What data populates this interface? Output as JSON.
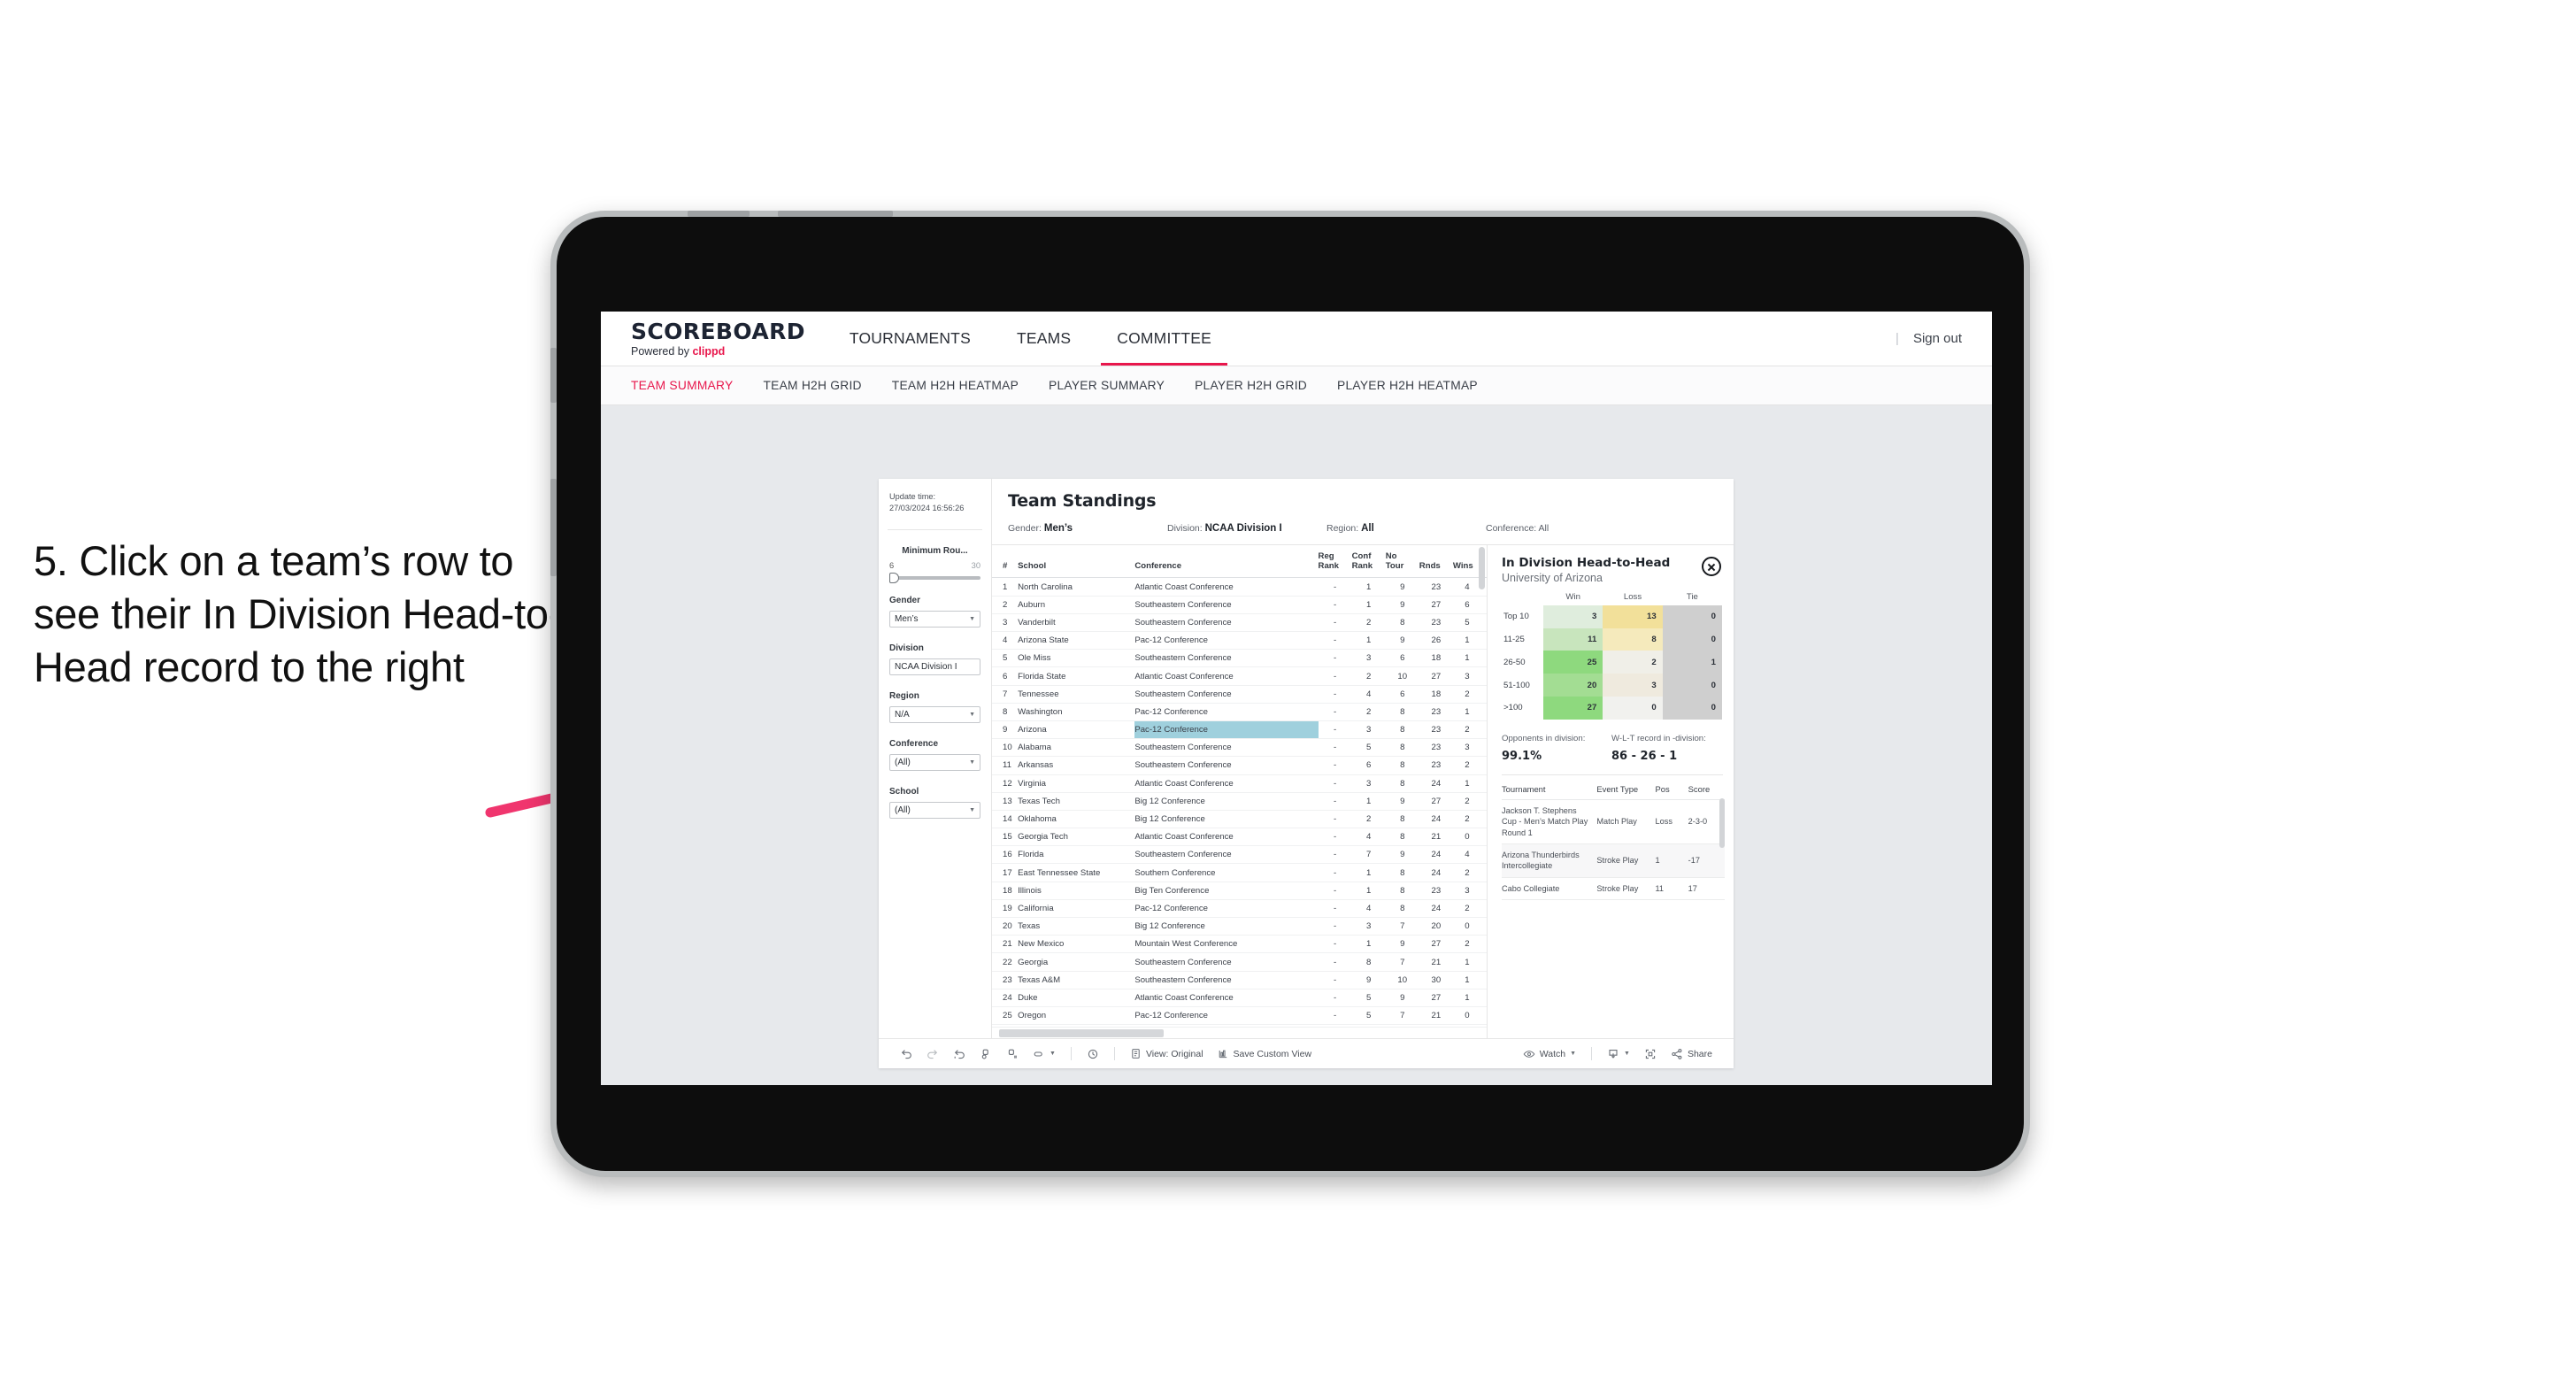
{
  "caption": "5. Click on a team’s row to see their In Division Head-to-Head record to the right",
  "appbar": {
    "logo": "SCOREBOARD",
    "powered_prefix": "Powered by ",
    "powered_brand": "clippd",
    "nav": [
      {
        "label": "TOURNAMENTS",
        "active": false
      },
      {
        "label": "TEAMS",
        "active": false
      },
      {
        "label": "COMMITTEE",
        "active": true
      }
    ],
    "divider": "|",
    "signout": "Sign out"
  },
  "subnav": [
    {
      "label": "TEAM SUMMARY",
      "active": true
    },
    {
      "label": "TEAM H2H GRID",
      "active": false
    },
    {
      "label": "TEAM H2H HEATMAP",
      "active": false
    },
    {
      "label": "PLAYER SUMMARY",
      "active": false
    },
    {
      "label": "PLAYER H2H GRID",
      "active": false
    },
    {
      "label": "PLAYER H2H HEATMAP",
      "active": false
    }
  ],
  "rail": {
    "update_label": "Update time:",
    "update_value": "27/03/2024 16:56:26",
    "slider": {
      "title": "Minimum Rou...",
      "min": "6",
      "max": "30"
    },
    "filters": [
      {
        "label": "Gender",
        "value": "Men’s"
      },
      {
        "label": "Division",
        "value": "NCAA Division I"
      },
      {
        "label": "Region",
        "value": "N/A"
      },
      {
        "label": "Conference",
        "value": "(All)"
      },
      {
        "label": "School",
        "value": "(All)"
      }
    ]
  },
  "standings": {
    "title": "Team Standings",
    "facets": [
      {
        "label": "Gender:",
        "value": "Men’s"
      },
      {
        "label": "Division:",
        "value": "NCAA Division I"
      },
      {
        "label": "Region:",
        "value": "All"
      },
      {
        "label": "Conference:",
        "value": "All"
      }
    ],
    "columns": [
      "#",
      "School",
      "Conference",
      "Reg Rank",
      "Conf Rank",
      "No Tour",
      "Rnds",
      "Wins"
    ],
    "columns_display": [
      {
        "l1": "#",
        "l2": ""
      },
      {
        "l1": "School",
        "l2": ""
      },
      {
        "l1": "Conference",
        "l2": ""
      },
      {
        "l1": "Reg",
        "l2": "Rank"
      },
      {
        "l1": "Conf",
        "l2": "Rank"
      },
      {
        "l1": "No",
        "l2": "Tour"
      },
      {
        "l1": "Rnds",
        "l2": ""
      },
      {
        "l1": "Wins",
        "l2": ""
      }
    ],
    "selected_row_index": 8,
    "rows": [
      {
        "n": "1",
        "school": "North Carolina",
        "conf": "Atlantic Coast Conference",
        "reg": "-",
        "crank": "1",
        "notour": "9",
        "rnds": "23",
        "wins": "4"
      },
      {
        "n": "2",
        "school": "Auburn",
        "conf": "Southeastern Conference",
        "reg": "-",
        "crank": "1",
        "notour": "9",
        "rnds": "27",
        "wins": "6"
      },
      {
        "n": "3",
        "school": "Vanderbilt",
        "conf": "Southeastern Conference",
        "reg": "-",
        "crank": "2",
        "notour": "8",
        "rnds": "23",
        "wins": "5"
      },
      {
        "n": "4",
        "school": "Arizona State",
        "conf": "Pac-12 Conference",
        "reg": "-",
        "crank": "1",
        "notour": "9",
        "rnds": "26",
        "wins": "1"
      },
      {
        "n": "5",
        "school": "Ole Miss",
        "conf": "Southeastern Conference",
        "reg": "-",
        "crank": "3",
        "notour": "6",
        "rnds": "18",
        "wins": "1"
      },
      {
        "n": "6",
        "school": "Florida State",
        "conf": "Atlantic Coast Conference",
        "reg": "-",
        "crank": "2",
        "notour": "10",
        "rnds": "27",
        "wins": "3"
      },
      {
        "n": "7",
        "school": "Tennessee",
        "conf": "Southeastern Conference",
        "reg": "-",
        "crank": "4",
        "notour": "6",
        "rnds": "18",
        "wins": "2"
      },
      {
        "n": "8",
        "school": "Washington",
        "conf": "Pac-12 Conference",
        "reg": "-",
        "crank": "2",
        "notour": "8",
        "rnds": "23",
        "wins": "1"
      },
      {
        "n": "9",
        "school": "Arizona",
        "conf": "Pac-12 Conference",
        "reg": "-",
        "crank": "3",
        "notour": "8",
        "rnds": "23",
        "wins": "2"
      },
      {
        "n": "10",
        "school": "Alabama",
        "conf": "Southeastern Conference",
        "reg": "-",
        "crank": "5",
        "notour": "8",
        "rnds": "23",
        "wins": "3"
      },
      {
        "n": "11",
        "school": "Arkansas",
        "conf": "Southeastern Conference",
        "reg": "-",
        "crank": "6",
        "notour": "8",
        "rnds": "23",
        "wins": "2"
      },
      {
        "n": "12",
        "school": "Virginia",
        "conf": "Atlantic Coast Conference",
        "reg": "-",
        "crank": "3",
        "notour": "8",
        "rnds": "24",
        "wins": "1"
      },
      {
        "n": "13",
        "school": "Texas Tech",
        "conf": "Big 12 Conference",
        "reg": "-",
        "crank": "1",
        "notour": "9",
        "rnds": "27",
        "wins": "2"
      },
      {
        "n": "14",
        "school": "Oklahoma",
        "conf": "Big 12 Conference",
        "reg": "-",
        "crank": "2",
        "notour": "8",
        "rnds": "24",
        "wins": "2"
      },
      {
        "n": "15",
        "school": "Georgia Tech",
        "conf": "Atlantic Coast Conference",
        "reg": "-",
        "crank": "4",
        "notour": "8",
        "rnds": "21",
        "wins": "0"
      },
      {
        "n": "16",
        "school": "Florida",
        "conf": "Southeastern Conference",
        "reg": "-",
        "crank": "7",
        "notour": "9",
        "rnds": "24",
        "wins": "4"
      },
      {
        "n": "17",
        "school": "East Tennessee State",
        "conf": "Southern Conference",
        "reg": "-",
        "crank": "1",
        "notour": "8",
        "rnds": "24",
        "wins": "2"
      },
      {
        "n": "18",
        "school": "Illinois",
        "conf": "Big Ten Conference",
        "reg": "-",
        "crank": "1",
        "notour": "8",
        "rnds": "23",
        "wins": "3"
      },
      {
        "n": "19",
        "school": "California",
        "conf": "Pac-12 Conference",
        "reg": "-",
        "crank": "4",
        "notour": "8",
        "rnds": "24",
        "wins": "2"
      },
      {
        "n": "20",
        "school": "Texas",
        "conf": "Big 12 Conference",
        "reg": "-",
        "crank": "3",
        "notour": "7",
        "rnds": "20",
        "wins": "0"
      },
      {
        "n": "21",
        "school": "New Mexico",
        "conf": "Mountain West Conference",
        "reg": "-",
        "crank": "1",
        "notour": "9",
        "rnds": "27",
        "wins": "2"
      },
      {
        "n": "22",
        "school": "Georgia",
        "conf": "Southeastern Conference",
        "reg": "-",
        "crank": "8",
        "notour": "7",
        "rnds": "21",
        "wins": "1"
      },
      {
        "n": "23",
        "school": "Texas A&M",
        "conf": "Southeastern Conference",
        "reg": "-",
        "crank": "9",
        "notour": "10",
        "rnds": "30",
        "wins": "1"
      },
      {
        "n": "24",
        "school": "Duke",
        "conf": "Atlantic Coast Conference",
        "reg": "-",
        "crank": "5",
        "notour": "9",
        "rnds": "27",
        "wins": "1"
      },
      {
        "n": "25",
        "school": "Oregon",
        "conf": "Pac-12 Conference",
        "reg": "-",
        "crank": "5",
        "notour": "7",
        "rnds": "21",
        "wins": "0"
      }
    ]
  },
  "h2h": {
    "title": "In Division Head-to-Head",
    "subtitle": "University of Arizona",
    "close_icon": "close-circle-icon",
    "matrix_headers": [
      "Win",
      "Loss",
      "Tie"
    ],
    "matrix_rows": [
      {
        "band": "Top 10",
        "win": "3",
        "loss": "13",
        "tie": "0",
        "win_color": "#dfeddd",
        "loss_color": "#f2e09a",
        "tie_color": "#cfcfcf"
      },
      {
        "band": "11-25",
        "win": "11",
        "loss": "8",
        "tie": "0",
        "win_color": "#c8e5bd",
        "loss_color": "#f5eabc",
        "tie_color": "#cfcfcf"
      },
      {
        "band": "26-50",
        "win": "25",
        "loss": "2",
        "tie": "1",
        "win_color": "#8ed97e",
        "loss_color": "#f0efe8",
        "tie_color": "#cfcfcf"
      },
      {
        "band": "51-100",
        "win": "20",
        "loss": "3",
        "tie": "0",
        "win_color": "#a3dd93",
        "loss_color": "#efeade",
        "tie_color": "#cfcfcf"
      },
      {
        "band": ">100",
        "win": "27",
        "loss": "0",
        "tie": "0",
        "win_color": "#8ed97e",
        "loss_color": "#f1f1ee",
        "tie_color": "#cfcfcf"
      }
    ],
    "stats": [
      {
        "label": "Opponents in division:",
        "value": "99.1%"
      },
      {
        "label": "W-L-T record in -division:",
        "value": "86 - 26 - 1"
      }
    ],
    "tourn_columns": [
      "Tournament",
      "Event Type",
      "Pos",
      "Score"
    ],
    "tourn_rows": [
      {
        "name": "Jackson T. Stephens Cup - Men’s Match Play Round 1",
        "event": "Match Play",
        "pos": "Loss",
        "score": "2-3-0"
      },
      {
        "name": "Arizona Thunderbirds Intercollegiate",
        "event": "Stroke Play",
        "pos": "1",
        "score": "-17"
      },
      {
        "name": "Cabo Collegiate",
        "event": "Stroke Play",
        "pos": "11",
        "score": "17"
      }
    ]
  },
  "toolbar": {
    "undo": "undo-icon",
    "redo": "redo-icon",
    "revert": "revert-icon",
    "refresh": "refresh-data-icon",
    "pause": "pause-updates-icon",
    "device": "device-layout-icon",
    "clock": "clock-icon",
    "view_label": "View: Original",
    "save_label": "Save Custom View",
    "watch_label": "Watch",
    "download": "download-icon",
    "fullscreen": "fullscreen-icon",
    "share_label": "Share"
  },
  "colors": {
    "accent": "#e8174c",
    "selected_cell": "#9fd0dd",
    "arrow": "#f0356e"
  }
}
